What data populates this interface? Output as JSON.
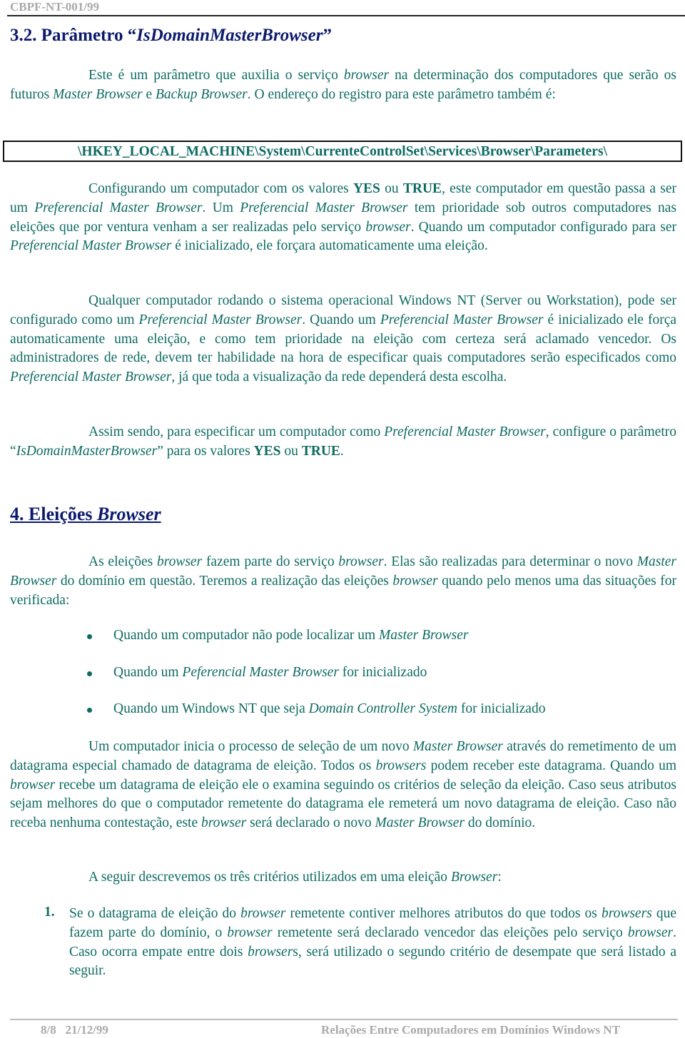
{
  "header": {
    "doc_code": "CBPF-NT-001/99"
  },
  "section_32": {
    "title_prefix": "3.2. Parâmetro “",
    "title_italic": "IsDomainMasterBrowser",
    "title_suffix": "”",
    "p1": [
      {
        "t": "Este é um parâmetro que auxilia o serviço "
      },
      {
        "t": "browser",
        "i": true
      },
      {
        "t": " na determinação dos computadores que serão os futuros "
      },
      {
        "t": "Master Browser",
        "i": true
      },
      {
        "t": " e "
      },
      {
        "t": "Backup Browser",
        "i": true
      },
      {
        "t": ". O endereço do registro para este parâmetro também é:"
      }
    ],
    "registry_path": "\\HKEY_LOCAL_MACHINE\\System\\CurrenteControlSet\\Services\\Browser\\Parameters\\",
    "p2": [
      {
        "t": "Configurando um computador com os valores "
      },
      {
        "t": "YES",
        "b": true
      },
      {
        "t": " ou "
      },
      {
        "t": "TRUE",
        "b": true
      },
      {
        "t": ", este computador em questão passa a ser um "
      },
      {
        "t": "Preferencial Master Browser",
        "i": true
      },
      {
        "t": ". Um "
      },
      {
        "t": "Preferencial Master Browser",
        "i": true
      },
      {
        "t": " tem prioridade sob outros computadores nas eleições que por ventura venham a ser realizadas pelo serviço "
      },
      {
        "t": "browser",
        "i": true
      },
      {
        "t": ". Quando um computador configurado para ser "
      },
      {
        "t": "Preferencial Master Browser",
        "i": true
      },
      {
        "t": " é inicializado, ele forçara automaticamente uma eleição."
      }
    ],
    "p3": [
      {
        "t": "Qualquer computador rodando o sistema operacional Windows NT (Server ou Workstation), pode ser configurado como um "
      },
      {
        "t": "Preferencial Master Browser",
        "i": true
      },
      {
        "t": ". Quando um "
      },
      {
        "t": "Preferencial Master Browser",
        "i": true
      },
      {
        "t": " é inicializado ele força automaticamente uma eleição, e como tem prioridade na eleição com certeza será aclamado vencedor. Os administradores de rede, devem ter habilidade na hora de especificar quais computadores serão especificados como "
      },
      {
        "t": "Preferencial Master Browser",
        "i": true
      },
      {
        "t": ", já que toda a visualização da rede dependerá desta escolha."
      }
    ],
    "p4": [
      {
        "t": "Assim sendo, para especificar um computador como "
      },
      {
        "t": "Preferencial Master Browser",
        "i": true
      },
      {
        "t": ", configure o parâmetro “"
      },
      {
        "t": "IsDomainMasterBrowser",
        "i": true
      },
      {
        "t": "” para os valores "
      },
      {
        "t": "YES",
        "b": true
      },
      {
        "t": " ou "
      },
      {
        "t": "TRUE",
        "b": true
      },
      {
        "t": "."
      }
    ]
  },
  "section_4": {
    "title_plain": "4. Eleições ",
    "title_italic": "Browser",
    "p1": [
      {
        "t": "As eleições "
      },
      {
        "t": "browser",
        "i": true
      },
      {
        "t": " fazem parte do serviço "
      },
      {
        "t": "browser",
        "i": true
      },
      {
        "t": ". Elas são realizadas para determinar o novo "
      },
      {
        "t": "Master Browser",
        "i": true
      },
      {
        "t": " do domínio em questão. Teremos a realização das eleições "
      },
      {
        "t": "browser",
        "i": true
      },
      {
        "t": " quando pelo menos uma das situações for verificada:"
      }
    ],
    "bullets": [
      [
        {
          "t": "Quando um computador não pode localizar um "
        },
        {
          "t": "Master Browser",
          "i": true
        }
      ],
      [
        {
          "t": "Quando um "
        },
        {
          "t": "Peferencial Master Browser",
          "i": true
        },
        {
          "t": " for inicializado"
        }
      ],
      [
        {
          "t": "Quando um Windows NT que seja "
        },
        {
          "t": "Domain Controller System",
          "i": true
        },
        {
          "t": " for inicializado"
        }
      ]
    ],
    "p2": [
      {
        "t": "Um computador inicia o processo de seleção de um novo "
      },
      {
        "t": "Master Browser",
        "i": true
      },
      {
        "t": " através do remetimento de um datagrama especial chamado de datagrama de eleição. Todos os "
      },
      {
        "t": "browsers",
        "i": true
      },
      {
        "t": " podem receber este datagrama. Quando um "
      },
      {
        "t": "browser",
        "i": true
      },
      {
        "t": " recebe um datagrama de eleição ele o examina seguindo os critérios de seleção da eleição. Caso seus atributos sejam melhores do que o computador remetente do datagrama ele remeterá um novo datagrama de eleição. Caso não receba nenhuma contestação, este "
      },
      {
        "t": "browser",
        "i": true
      },
      {
        "t": " será declarado o novo "
      },
      {
        "t": "Master Browser",
        "i": true
      },
      {
        "t": " do domínio."
      }
    ],
    "p3": [
      {
        "t": "A seguir descrevemos os três critérios utilizados em uma eleição "
      },
      {
        "t": "Browser",
        "i": true
      },
      {
        "t": ":"
      }
    ],
    "numbered": [
      {
        "num": "1.",
        "content": [
          {
            "t": "Se o datagrama de eleição do "
          },
          {
            "t": "browser",
            "i": true
          },
          {
            "t": " remetente contiver melhores atributos do que todos os "
          },
          {
            "t": "browsers",
            "i": true
          },
          {
            "t": " que fazem parte do domínio, o "
          },
          {
            "t": "browser",
            "i": true
          },
          {
            "t": " remetente será declarado vencedor das eleições pelo serviço "
          },
          {
            "t": "browser",
            "i": true
          },
          {
            "t": ". Caso ocorra empate entre dois "
          },
          {
            "t": "browser",
            "i": true
          },
          {
            "t": "s, será utilizado o segundo critério de desempate que será listado a seguir."
          }
        ]
      }
    ]
  },
  "footer": {
    "page": "8/8",
    "date": "21/12/99",
    "title": "Relações Entre Computadores em Domínios Windows NT"
  }
}
